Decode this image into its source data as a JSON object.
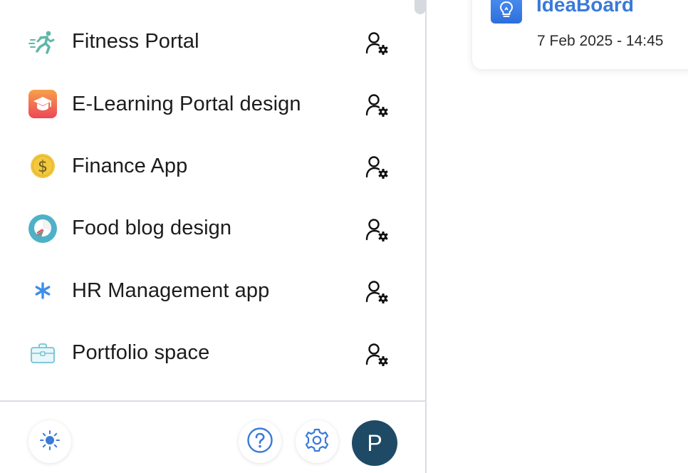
{
  "workspaces": [
    {
      "name": "Fitness Portal",
      "icon": "running-person-icon",
      "color": "#5fb7a8"
    },
    {
      "name": "E-Learning Portal design",
      "icon": "graduation-cap-icon",
      "color": "#f0564e"
    },
    {
      "name": "Finance App",
      "icon": "dollar-coin-icon",
      "color": "#f2c840"
    },
    {
      "name": "Food blog design",
      "icon": "food-plate-icon",
      "color": "#4fb1c8"
    },
    {
      "name": "HR Management app",
      "icon": "asterisk-icon",
      "color": "#3c8ee8"
    },
    {
      "name": "Portfolio space",
      "icon": "briefcase-icon",
      "color": "#6fc3d6"
    }
  ],
  "workspace_manage_icon": "user-settings-icon",
  "footer": {
    "theme_icon": "sun-icon",
    "help_icon": "help-icon",
    "settings_icon": "gear-icon",
    "avatar_initial": "P",
    "accent": "#3a7ad8",
    "avatar_color": "#1f4a66"
  },
  "recent_card": {
    "title": "IdeaBoard",
    "date": "7 Feb 2025 - 14:45",
    "icon": "lightbulb-icon"
  }
}
